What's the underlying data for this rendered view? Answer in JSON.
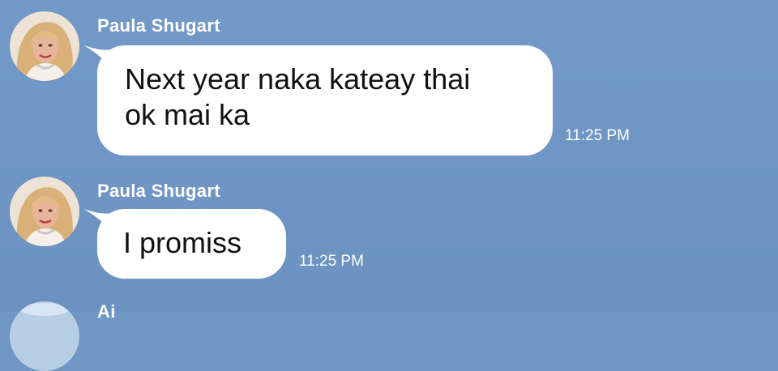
{
  "chat": {
    "messages": [
      {
        "sender": "Paula Shugart",
        "avatar_icon": "user-avatar-photo",
        "text": "Next year naka kateay thai\nok mai ka",
        "time": "11:25 PM"
      },
      {
        "sender": "Paula Shugart",
        "avatar_icon": "user-avatar-photo",
        "text": "I promiss",
        "time": "11:25 PM"
      },
      {
        "sender": "Ai",
        "avatar_icon": "user-avatar-photo"
      }
    ]
  },
  "colors": {
    "background": "#7097c6",
    "bubble": "#ffffff",
    "text": "#111111",
    "meta_text": "#ffffff"
  }
}
